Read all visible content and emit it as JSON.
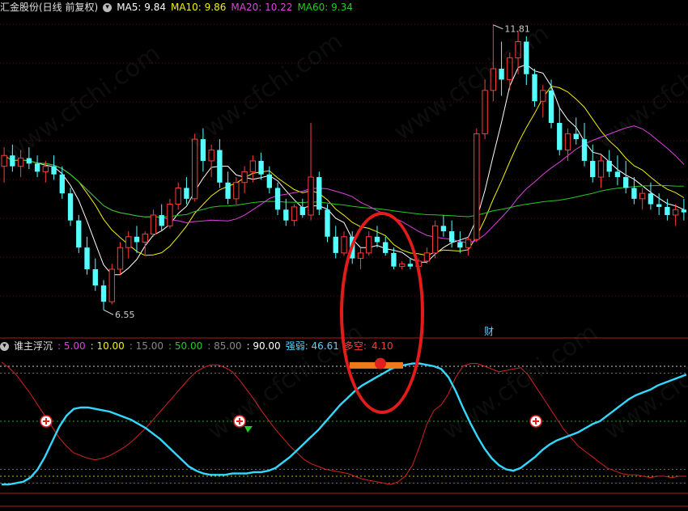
{
  "main_header": {
    "title": "汇金股份(日线 前复权)",
    "items": [
      {
        "label": "MA5:",
        "value": "9.84",
        "color": "#ffffff"
      },
      {
        "label": "MA10:",
        "value": "9.86",
        "color": "#f2f200"
      },
      {
        "label": "MA20:",
        "value": "10.22",
        "color": "#e040e0"
      },
      {
        "label": "MA60:",
        "value": "9.34",
        "color": "#22cc22"
      }
    ]
  },
  "sub_header": {
    "title": "谁主浮沉",
    "items": [
      {
        "text": ": 5.00",
        "color": "#e040e0"
      },
      {
        "text": ": 10.00",
        "color": "#f2f200"
      },
      {
        "text": ": 15.00",
        "color": "#888888"
      },
      {
        "text": ": 50.00",
        "color": "#22cc22"
      },
      {
        "text": ": 85.00",
        "color": "#888888"
      },
      {
        "text": ": 90.00",
        "color": "#ffffff"
      },
      {
        "text": "强弱: 46.61",
        "color": "#5ad0ff"
      },
      {
        "text": "多空:",
        "color": "#ff3b3b"
      },
      {
        "text": "4.10",
        "color": "#ff3b3b"
      }
    ]
  },
  "watermark": "www.cfchi.com",
  "chart_data": {
    "type": "candlestick",
    "price_high_label": "11.81",
    "price_low_label": "6.55",
    "event_label": "财",
    "ma_series": [
      "MA5",
      "MA10",
      "MA20",
      "MA60"
    ],
    "price_range": [
      6.3,
      12.0
    ],
    "candles": [
      [
        9.2,
        9.55,
        8.9,
        9.4
      ],
      [
        9.4,
        9.6,
        9.1,
        9.2
      ],
      [
        9.2,
        9.5,
        9.0,
        9.35
      ],
      [
        9.35,
        9.55,
        9.15,
        9.25
      ],
      [
        9.25,
        9.4,
        9.0,
        9.1
      ],
      [
        9.1,
        9.3,
        8.9,
        9.2
      ],
      [
        9.2,
        9.4,
        8.95,
        9.05
      ],
      [
        9.05,
        9.2,
        8.6,
        8.7
      ],
      [
        8.7,
        8.8,
        8.1,
        8.2
      ],
      [
        8.2,
        8.3,
        7.6,
        7.7
      ],
      [
        7.7,
        7.9,
        7.2,
        7.3
      ],
      [
        7.3,
        7.5,
        6.9,
        7.0
      ],
      [
        7.0,
        7.1,
        6.55,
        6.7
      ],
      [
        6.7,
        7.4,
        6.65,
        7.3
      ],
      [
        7.3,
        7.8,
        7.2,
        7.7
      ],
      [
        7.7,
        8.0,
        7.5,
        7.9
      ],
      [
        7.9,
        8.1,
        7.6,
        7.8
      ],
      [
        7.8,
        8.0,
        7.55,
        7.95
      ],
      [
        7.95,
        8.4,
        7.9,
        8.3
      ],
      [
        8.3,
        8.5,
        8.0,
        8.1
      ],
      [
        8.1,
        8.6,
        8.05,
        8.5
      ],
      [
        8.5,
        8.9,
        8.4,
        8.8
      ],
      [
        8.8,
        9.0,
        8.5,
        8.6
      ],
      [
        8.6,
        9.8,
        8.55,
        9.7
      ],
      [
        9.7,
        9.9,
        9.1,
        9.3
      ],
      [
        9.3,
        9.6,
        9.0,
        9.5
      ],
      [
        9.5,
        9.7,
        8.8,
        8.9
      ],
      [
        8.9,
        9.1,
        8.5,
        8.6
      ],
      [
        8.6,
        9.0,
        8.5,
        8.9
      ],
      [
        8.9,
        9.2,
        8.7,
        9.1
      ],
      [
        9.1,
        9.4,
        8.9,
        9.3
      ],
      [
        9.3,
        9.45,
        8.95,
        9.05
      ],
      [
        9.05,
        9.2,
        8.7,
        8.8
      ],
      [
        8.8,
        8.9,
        8.3,
        8.4
      ],
      [
        8.4,
        8.6,
        8.1,
        8.2
      ],
      [
        8.2,
        8.5,
        8.1,
        8.45
      ],
      [
        8.45,
        8.6,
        8.25,
        8.3
      ],
      [
        8.3,
        10.0,
        8.2,
        9.0
      ],
      [
        9.0,
        9.1,
        8.3,
        8.4
      ],
      [
        8.4,
        8.5,
        7.8,
        7.9
      ],
      [
        7.9,
        8.1,
        7.5,
        7.6
      ],
      [
        7.6,
        8.0,
        7.55,
        7.9
      ],
      [
        7.9,
        8.0,
        7.4,
        7.5
      ],
      [
        7.5,
        7.7,
        7.3,
        7.6
      ],
      [
        7.6,
        8.0,
        7.55,
        7.9
      ],
      [
        7.9,
        8.1,
        7.7,
        7.8
      ],
      [
        7.8,
        7.9,
        7.55,
        7.6
      ],
      [
        7.6,
        7.7,
        7.3,
        7.35
      ],
      [
        7.35,
        7.45,
        7.3,
        7.4
      ],
      [
        7.4,
        7.5,
        7.3,
        7.35
      ],
      [
        7.35,
        7.5,
        7.25,
        7.45
      ],
      [
        7.45,
        7.7,
        7.4,
        7.6
      ],
      [
        7.6,
        8.2,
        7.5,
        8.1
      ],
      [
        8.1,
        8.3,
        7.9,
        8.0
      ],
      [
        8.0,
        8.2,
        7.7,
        7.8
      ],
      [
        7.8,
        8.0,
        7.6,
        7.7
      ],
      [
        7.7,
        7.9,
        7.55,
        7.85
      ],
      [
        7.85,
        9.9,
        7.8,
        9.8
      ],
      [
        9.8,
        10.8,
        9.7,
        10.6
      ],
      [
        10.6,
        11.81,
        10.4,
        11.0
      ],
      [
        11.0,
        11.5,
        10.5,
        10.8
      ],
      [
        10.8,
        11.3,
        10.6,
        11.2
      ],
      [
        11.2,
        11.7,
        10.9,
        11.5
      ],
      [
        11.5,
        11.6,
        10.7,
        10.9
      ],
      [
        10.9,
        11.0,
        10.3,
        10.4
      ],
      [
        10.4,
        10.7,
        10.1,
        10.6
      ],
      [
        10.6,
        10.8,
        9.9,
        10.0
      ],
      [
        10.0,
        10.3,
        9.4,
        9.5
      ],
      [
        9.5,
        9.9,
        9.3,
        9.8
      ],
      [
        9.8,
        10.1,
        9.6,
        9.7
      ],
      [
        9.7,
        10.0,
        9.2,
        9.3
      ],
      [
        9.3,
        9.6,
        8.9,
        9.0
      ],
      [
        9.0,
        9.4,
        8.8,
        9.3
      ],
      [
        9.3,
        9.5,
        9.0,
        9.1
      ],
      [
        9.1,
        9.4,
        8.85,
        9.0
      ],
      [
        9.0,
        9.3,
        8.7,
        8.8
      ],
      [
        8.8,
        9.0,
        8.5,
        8.6
      ],
      [
        8.6,
        8.8,
        8.4,
        8.7
      ],
      [
        8.7,
        8.9,
        8.4,
        8.5
      ],
      [
        8.5,
        8.7,
        8.3,
        8.45
      ],
      [
        8.45,
        8.6,
        8.2,
        8.3
      ],
      [
        8.3,
        8.5,
        8.1,
        8.4
      ],
      [
        8.4,
        8.6,
        8.2,
        8.35
      ]
    ],
    "oscillator_range": [
      0,
      100
    ],
    "oscillator_levels": [
      5,
      10,
      15,
      50,
      85,
      90
    ],
    "strength": [
      4,
      4,
      5,
      6,
      9,
      15,
      24,
      35,
      46,
      54,
      59,
      60,
      60,
      59,
      58,
      57,
      55,
      53,
      51,
      48,
      45,
      41,
      37,
      32,
      27,
      22,
      17,
      14,
      12,
      11,
      11,
      11,
      12,
      12,
      12,
      13,
      13,
      14,
      16,
      20,
      24,
      29,
      34,
      39,
      44,
      50,
      56,
      62,
      67,
      72,
      76,
      79,
      82,
      85,
      88,
      90,
      91,
      92,
      92,
      91,
      90,
      88,
      82,
      72,
      60,
      49,
      39,
      30,
      23,
      18,
      15,
      14,
      16,
      20,
      24,
      29,
      33,
      36,
      38,
      40,
      42,
      45,
      48,
      50,
      54,
      58,
      62,
      66,
      69,
      71,
      73,
      76,
      78,
      80,
      82,
      84
    ],
    "long_short": [
      93,
      89,
      84,
      77,
      70,
      62,
      54,
      46,
      38,
      32,
      27,
      25,
      23,
      22,
      23,
      25,
      28,
      31,
      35,
      40,
      45,
      51,
      57,
      63,
      69,
      75,
      81,
      86,
      89,
      91,
      91,
      89,
      86,
      80,
      73,
      66,
      58,
      51,
      44,
      38,
      32,
      27,
      22,
      19,
      17,
      15,
      14,
      13,
      12,
      10,
      8,
      7,
      6,
      5,
      4,
      6,
      10,
      18,
      32,
      48,
      58,
      62,
      70,
      82,
      90,
      92,
      92,
      90,
      88,
      86,
      87,
      88,
      89,
      84,
      76,
      68,
      60,
      52,
      44,
      38,
      32,
      28,
      24,
      20,
      16,
      14,
      12,
      11,
      11,
      10,
      9,
      10,
      10,
      9,
      10,
      10
    ]
  }
}
